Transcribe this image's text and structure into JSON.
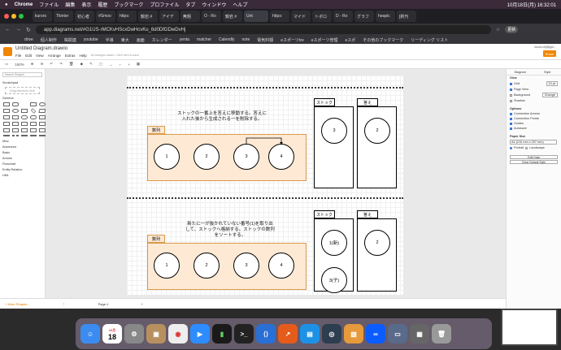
{
  "mac_menu": {
    "apple": "",
    "app": "Chrome",
    "items": [
      "ファイル",
      "編集",
      "表示",
      "履歴",
      "ブックマーク",
      "プロファイル",
      "タブ",
      "ウィンドウ",
      "ヘルプ"
    ],
    "clock": "10月18日(月) 16:32:01"
  },
  "tabs": [
    "kuroro",
    "Tkinter",
    "初心者",
    "#Smoo",
    "https:",
    "鏡岩 #",
    "アイデ",
    "無題",
    "O - Ro",
    "鏡岩 #",
    "Unt",
    "https:",
    "マイド",
    "トポロ",
    "D - Ro",
    "グラフ",
    "heapic",
    "[新刊"
  ],
  "address": {
    "url": "app.diagrams.net/#G1US-rMCKvHScxDwHcvKu_6d0DfGDwDvHj",
    "update": "更新"
  },
  "bookmarks": [
    "drive",
    "個人制作",
    "株関連",
    "youtube",
    "半導",
    "東大",
    "画面",
    "カレンダー",
    "yenta",
    "matcher",
    "Calendly",
    "note",
    "電気料額",
    "eスポーツtre",
    "eスポーツ管理",
    "eスポ",
    "その他のブックマーク",
    "リーディング リスト"
  ],
  "app": {
    "file_title": "Untitled Diagram.drawio",
    "menu": [
      "File",
      "Edit",
      "View",
      "Arrange",
      "Extras",
      "Help"
    ],
    "unsaved": "All changes saved / Click here to save",
    "user": "kuroro.eiji@gm...",
    "share": "Share",
    "zoom": "150%"
  },
  "left": {
    "search_placeholder": "Search Shapes",
    "scratchpad": "Scratchpad",
    "drag_hint": "Drag elements here",
    "general": "General",
    "sections": [
      "Misc",
      "Advanced",
      "Basic",
      "Arrows",
      "Flowchart",
      "Entity Relation",
      "UML"
    ],
    "more": "+ More Shapes..."
  },
  "diagram1": {
    "note": "ストックの一番上を答えに移動する。答えに入れた後から生成される一を削除する。",
    "array": "数列",
    "circles": [
      "1",
      "2",
      "3",
      "4"
    ],
    "stock": "ストック",
    "answer": "答え",
    "stock_val": "3",
    "answer_val": "2"
  },
  "diagram2": {
    "note": "新たに一が抜かれていない番号(1)を取り出して、ストックへ格納する。ストックの数列をソートする。",
    "array": "数列",
    "circles": [
      "1",
      "2",
      "3",
      "4"
    ],
    "stock": "ストック",
    "answer": "答え",
    "stock_top": "1(新)",
    "stock_bottom": "3(子)",
    "answer_val": "2"
  },
  "right": {
    "tabs": [
      "Diagram",
      "Style"
    ],
    "view": "View",
    "grid": "Grid",
    "grid_size": "10 pt",
    "page_view": "Page View",
    "background": "Background",
    "change": "Change",
    "shadow": "Shadow",
    "options": "Options",
    "opts": [
      "Connection Arrows",
      "Connection Points",
      "Guides",
      "Autosave"
    ],
    "paper_size": "Paper Size",
    "paper": "A4 (210 mm x 297 mm)",
    "portrait": "Portrait",
    "landscape": "Landscape",
    "edit_data": "Edit Data",
    "clear_style": "Clear Default Style"
  },
  "pagebar": {
    "more": "+ More Shapes...",
    "page": "Page-1"
  },
  "dock": {
    "date_num": "18",
    "date_month": "10月"
  }
}
